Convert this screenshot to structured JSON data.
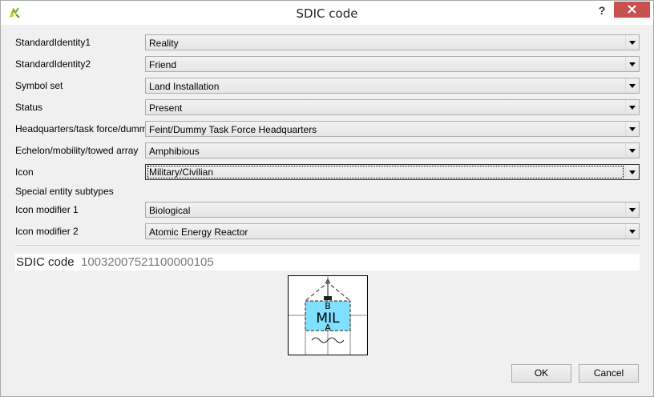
{
  "window": {
    "title": "SDIC code",
    "help_label": "?"
  },
  "fields": [
    {
      "label": "StandardIdentity1",
      "value": "Reality"
    },
    {
      "label": "StandardIdentity2",
      "value": "Friend"
    },
    {
      "label": "Symbol set",
      "value": "Land Installation"
    },
    {
      "label": "Status",
      "value": "Present"
    },
    {
      "label": "Headquarters/task force/dummy",
      "value": "Feint/Dummy Task Force Headquarters"
    },
    {
      "label": "Echelon/mobility/towed array",
      "value": "Amphibious"
    },
    {
      "label": "Icon",
      "value": "Military/Civilian"
    }
  ],
  "special_entity_label": "Special entity subtypes",
  "modifiers": [
    {
      "label": "Icon modifier 1",
      "value": "Biological"
    },
    {
      "label": "Icon modifier 2",
      "value": "Atomic Energy Reactor"
    }
  ],
  "sdic": {
    "label": "SDIC code",
    "value": "10032007521100000105"
  },
  "symbol": {
    "main_text": "MIL",
    "top_modifier": "B",
    "bottom_modifier": "A",
    "fill_color": "#80e0ff"
  },
  "buttons": {
    "ok": "OK",
    "cancel": "Cancel"
  }
}
